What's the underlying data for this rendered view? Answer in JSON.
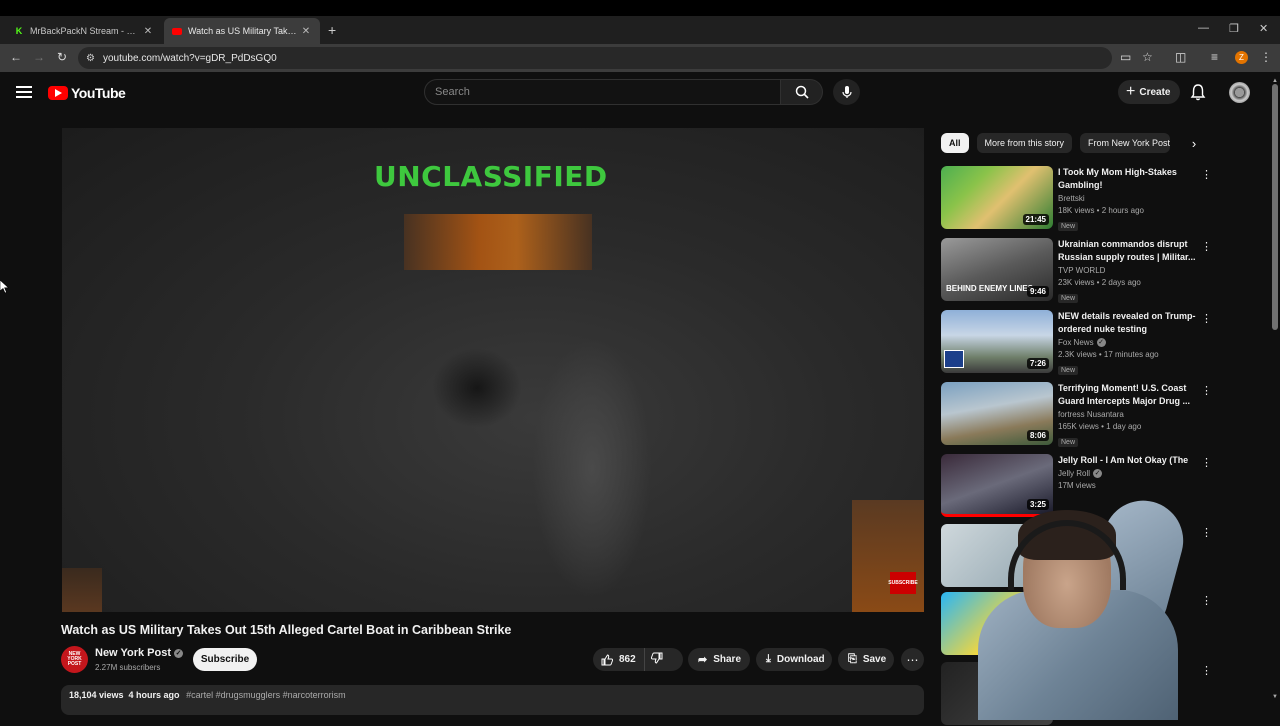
{
  "browser": {
    "tabs": [
      {
        "title": "MrBackPackN Stream - Watch l",
        "favicon": "kick-icon",
        "color": "#53fc18"
      },
      {
        "title": "Watch as US Military Takes Out",
        "favicon": "youtube-icon",
        "color": "#ff0000"
      }
    ],
    "url": "youtube.com/watch?v=gDR_PdDsGQ0",
    "profile_initial": "Z"
  },
  "header": {
    "logo_text": "YouTube",
    "search_placeholder": "Search",
    "create_label": "Create"
  },
  "player": {
    "overlay_text": "UNCLASSIFIED",
    "watermark": "SUBSCRIBE"
  },
  "video": {
    "title": "Watch as US Military Takes Out 15th Alleged Cartel Boat in Caribbean Strike",
    "channel": "New York Post",
    "channel_avatar_text": "NEW YORK POST",
    "subscribers": "2.27M subscribers",
    "subscribe_label": "Subscribe",
    "likes": "862",
    "share_label": "Share",
    "download_label": "Download",
    "save_label": "Save",
    "views_time": "18,104 views  4 hours ago",
    "hashtags": "#cartel #drugsmugglers #narcoterrorism"
  },
  "sidebar": {
    "chips": [
      "All",
      "More from this story",
      "From New York Post"
    ],
    "recommendations": [
      {
        "title": "I Took My Mom High-Stakes Gambling!",
        "channel": "Brettski",
        "meta": "18K views • 2 hours ago",
        "badge": "New",
        "duration": "21:45"
      },
      {
        "title": "Ukrainian commandos disrupt Russian supply routes | Militar...",
        "channel": "TVP WORLD",
        "meta": "23K views • 2 days ago",
        "badge": "New",
        "duration": "9:46",
        "thumb_text": "BEHIND ENEMY LINES"
      },
      {
        "title": "NEW details revealed on Trump-ordered nuke testing",
        "channel": "Fox News",
        "meta": "2.3K views • 17 minutes ago",
        "badge": "New",
        "duration": "7:26"
      },
      {
        "title": "Terrifying Moment! U.S. Coast Guard Intercepts Major Drug ...",
        "channel": "fortress Nusantara",
        "meta": "165K views • 1 day ago",
        "badge": "New",
        "duration": "8:06"
      },
      {
        "title": "Jelly Roll - I Am Not Okay (The",
        "channel": "Jelly Roll",
        "meta": "17M views",
        "badge": "",
        "duration": "3:25"
      }
    ]
  }
}
